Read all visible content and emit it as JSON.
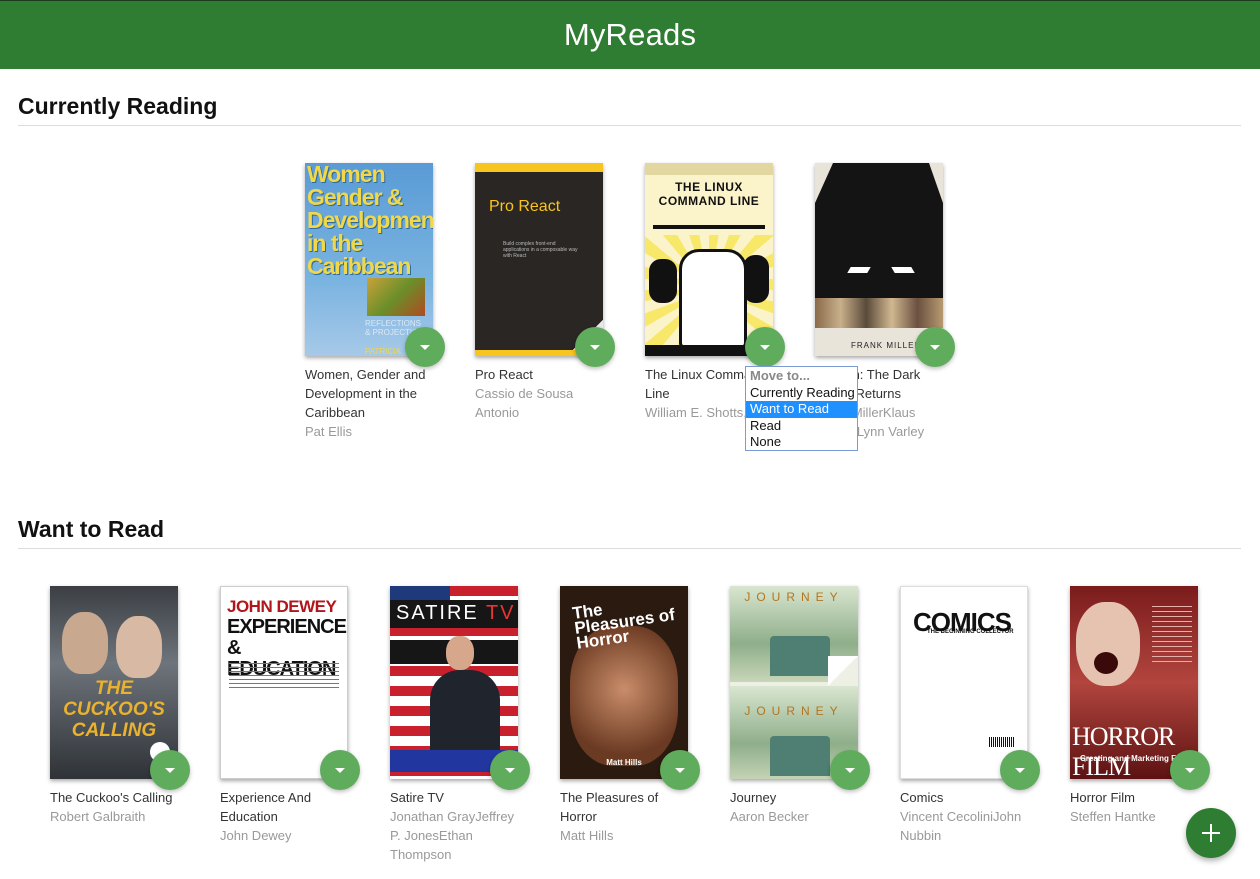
{
  "header": {
    "title": "MyReads"
  },
  "shelves": [
    {
      "title": "Currently Reading",
      "books": [
        {
          "title": "Women, Gender and Development in the Caribbean",
          "author": "Pat Ellis",
          "cover_text": "Women Gender & Development in the Caribbean"
        },
        {
          "title": "Pro React",
          "author": "Cassio de Sousa Antonio",
          "cover_text": "Pro React"
        },
        {
          "title": "The Linux Command Line",
          "author": "William E. Shotts, Jr.",
          "cover_text": "THE LINUX COMMAND LINE"
        },
        {
          "title": "Batman: The Dark Knight Returns",
          "author": "Frank MillerKlaus JansonLynn Varley",
          "cover_text": "FRANK MILLER"
        }
      ]
    },
    {
      "title": "Want to Read",
      "books": [
        {
          "title": "The Cuckoo's Calling",
          "author": "Robert Galbraith",
          "cover_text": "THE CUCKOO'S CALLING"
        },
        {
          "title": "Experience And Education",
          "author": "John Dewey",
          "cover_text": "EXPERIENCE & EDUCATION",
          "cover_author": "JOHN DEWEY"
        },
        {
          "title": "Satire TV",
          "author": "Jonathan GrayJeffrey P. JonesEthan Thompson",
          "cover_text": "SATIRE",
          "cover_text2": "TV"
        },
        {
          "title": "The Pleasures of Horror",
          "author": "Matt Hills",
          "cover_text": "The Pleasures of Horror",
          "cover_author": "Matt Hills"
        },
        {
          "title": "Journey",
          "author": "Aaron Becker",
          "cover_text": "JOURNEY"
        },
        {
          "title": "Comics",
          "author": "Vincent CecoliniJohn Nubbin",
          "cover_text": "COMICS",
          "cover_sub": "THE BEGINNING COLLECTOR"
        },
        {
          "title": "Horror Film",
          "author": "Steffen Hantke",
          "cover_text": "HORROR FILM",
          "cover_sub": "Creating and Marketing Fear"
        }
      ]
    }
  ],
  "shelf_menu": {
    "heading": "Move to...",
    "options": [
      "Currently Reading",
      "Want to Read",
      "Read",
      "None"
    ],
    "selected": "Want to Read"
  },
  "add_button_label": "+",
  "colors": {
    "header": "#2e7d32",
    "changer": "#60ac5d",
    "menu_highlight": "#1e90ff"
  }
}
